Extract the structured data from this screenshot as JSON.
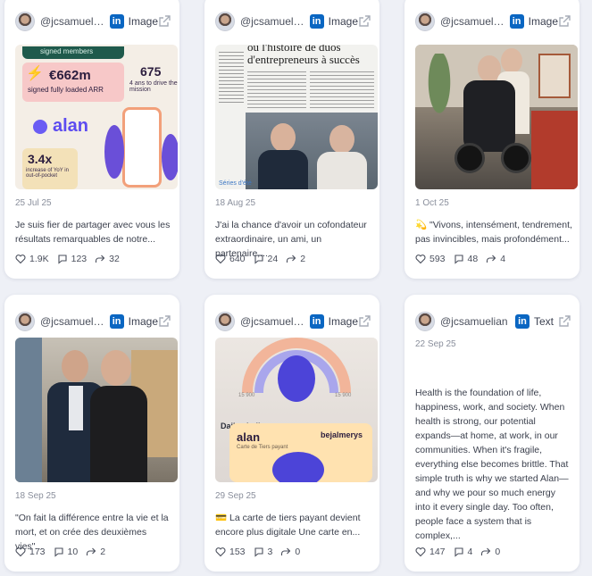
{
  "posts": [
    {
      "handle": "@jcsamuelli...",
      "network": "in",
      "type": "Image",
      "date": "25 Jul 25",
      "text": "Je suis fier de partager avec vous les résultats remarquables de notre...",
      "likes": "1.9K",
      "comments": "123",
      "shares": "32",
      "media_text": {
        "a": "signed members",
        "b": "€662m",
        "c": "signed fully loaded ARR",
        "d": "675",
        "e": "4 ans to drive the mission",
        "f": "alan",
        "g": "3.4x",
        "h": "increase of YoY in out-of-pocket"
      }
    },
    {
      "handle": "@jcsamuelli...",
      "network": "in",
      "type": "Image",
      "date": "18 Aug 25",
      "text": "J'ai la chance d'avoir un cofondateur extraordinaire, un ami, un partenaire,...",
      "likes": "640",
      "comments": "24",
      "shares": "2",
      "media_text": {
        "a": "ou l'histoire de duos d'entrepreneurs à succès",
        "b": "Séries d'été"
      }
    },
    {
      "handle": "@jcsamuelli...",
      "network": "in",
      "type": "Image",
      "date": "1 Oct 25",
      "text": "💫 \"Vivons, intensément, tendrement, pas invincibles, mais profondément...",
      "likes": "593",
      "comments": "48",
      "shares": "4"
    },
    {
      "handle": "@jcsamuelli...",
      "network": "in",
      "type": "Image",
      "date": "18 Sep 25",
      "text": "\"On fait la différence entre la vie et la mort, et on crée des deuxièmes vies\"...",
      "likes": "173",
      "comments": "10",
      "shares": "2"
    },
    {
      "handle": "@jcsamuelli...",
      "network": "in",
      "type": "Image",
      "date": "29 Sep 25",
      "text": "💳 La carte de tiers payant devient encore plus digitale Une carte en...",
      "likes": "153",
      "comments": "3",
      "shares": "0",
      "media_text": {
        "a": "15 900",
        "b": "15 900",
        "c": "Daily challenge",
        "d": "alan",
        "e": "bejalmerys",
        "f": "Carte de Tiers payant"
      }
    },
    {
      "handle": "@jcsamuelian",
      "network": "in",
      "type": "Text",
      "date": "22 Sep 25",
      "text": "Health is the foundation of life, happiness, work, and society. When health is strong, our potential expands—at home, at work, in our communities. When it's fragile, everything else becomes brittle. That simple truth is why we started Alan—and why we pour so much energy into it every single day. Too often, people face a system that is complex,...",
      "likes": "147",
      "comments": "4",
      "shares": "0"
    }
  ],
  "icons": {
    "network": "linkedin-icon",
    "external": "external-link-icon",
    "like": "heart-icon",
    "comment": "comment-icon",
    "share": "share-icon"
  },
  "colors": {
    "linkedin": "#0a66c2",
    "background": "#eef0f6",
    "card": "#ffffff"
  }
}
